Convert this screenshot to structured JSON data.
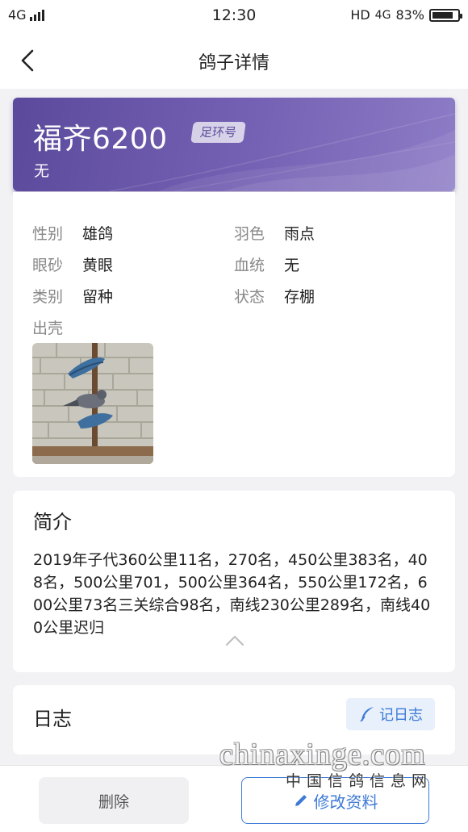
{
  "status_bar": {
    "network": "4G",
    "time": "12:30",
    "hd_label": "HD",
    "right_network": "4G",
    "battery_text": "83%",
    "battery_level": 0.83
  },
  "nav": {
    "title": "鸽子详情"
  },
  "hero": {
    "name": "福齐6200",
    "badge": "足环号",
    "subtitle": "无"
  },
  "details": [
    {
      "label": "性别",
      "value": "雄鸽"
    },
    {
      "label": "羽色",
      "value": "雨点"
    },
    {
      "label": "眼砂",
      "value": "黄眼"
    },
    {
      "label": "血统",
      "value": "无"
    },
    {
      "label": "类别",
      "value": "留种"
    },
    {
      "label": "状态",
      "value": "存棚"
    },
    {
      "label": "出壳",
      "value": ""
    }
  ],
  "intro": {
    "title": "简介",
    "text": "2019年子代360公里11名，270名，450公里383名，408名，500公里701，500公里364名，550公里172名，600公里73名三关综合98名，南线230公里289名，南线400公里迟归"
  },
  "log": {
    "title": "日志",
    "button_label": "记日志"
  },
  "actions": {
    "delete_label": "删除",
    "edit_label": "修改资料"
  },
  "watermark": {
    "en": "chinaxinge.com",
    "cn": "中国信鸽信息网"
  },
  "colors": {
    "hero_purple": "#6a58aa",
    "accent_blue": "#3d7ad6",
    "background": "#f2f2f4"
  }
}
